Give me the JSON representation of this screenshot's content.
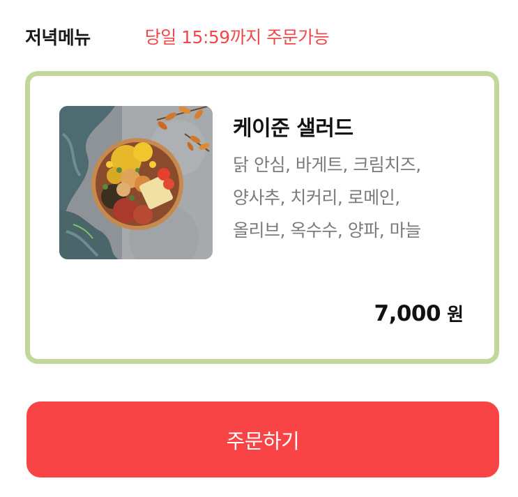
{
  "header": {
    "title": "저녁메뉴",
    "deadline": "당일 15:59까지 주문가능"
  },
  "menu": {
    "image_icon": "salad-bowl-photo",
    "name": "케이준 샐러드",
    "ingredients": [
      "닭 안심, 바게트, 크림치즈,",
      "양사추, 치커리, 로메인,",
      "올리브, 옥수수, 양파, 마늘"
    ],
    "price": "7,000",
    "currency": "원"
  },
  "order_button": {
    "label": "주문하기"
  },
  "colors": {
    "accent": "#f84444",
    "deadline_text": "#f0484a",
    "card_border": "#c2d89a",
    "ingredient_text": "#7a7a7a"
  }
}
